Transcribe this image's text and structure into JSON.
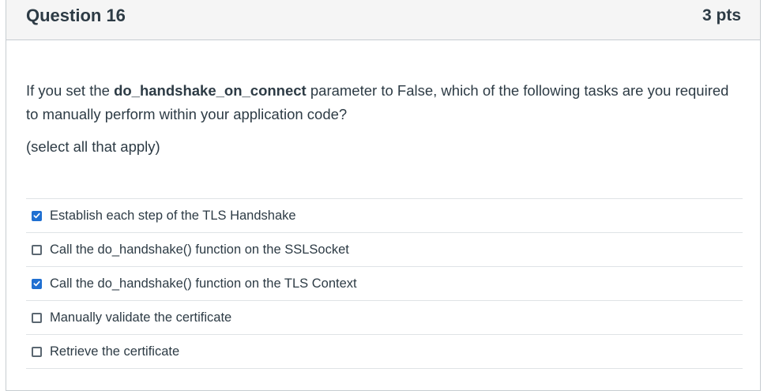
{
  "question": {
    "title": "Question 16",
    "points": "3 pts",
    "prompt_before": "If you set the ",
    "prompt_keyword": "do_handshake_on_connect",
    "prompt_after": " parameter to False, which of the following tasks are you required to manually perform within your application code?",
    "instruction": "(select all that apply)"
  },
  "answers": [
    {
      "label": "Establish each step of the TLS Handshake",
      "checked": true
    },
    {
      "label": "Call the do_handshake() function on the SSLSocket",
      "checked": false
    },
    {
      "label": "Call the do_handshake() function on the TLS Context",
      "checked": true
    },
    {
      "label": "Manually validate the certificate",
      "checked": false
    },
    {
      "label": "Retrieve the certificate",
      "checked": false
    }
  ],
  "colors": {
    "accent": "#1f6fd1",
    "header_bg": "#f5f5f5",
    "text": "#2d3b45"
  }
}
